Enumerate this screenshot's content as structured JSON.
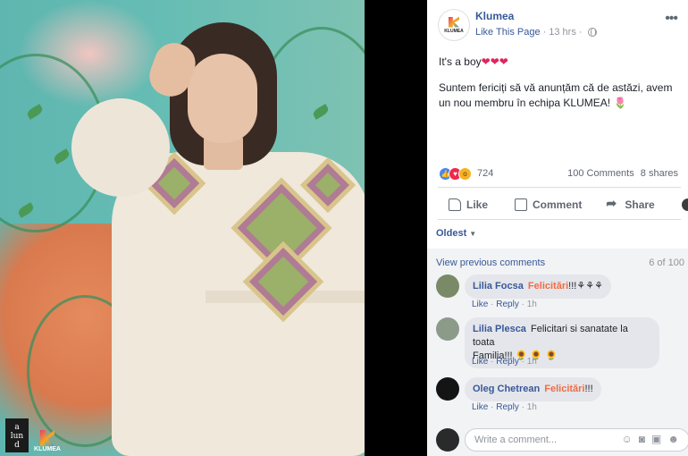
{
  "photo": {
    "watermark_left": "a\nlun\nd",
    "watermark_right": "KLUMEA"
  },
  "post": {
    "page_name": "Klumea",
    "avatar_label": "KLUMEA",
    "like_page": "Like This Page",
    "time": "13 hrs",
    "separator": "·",
    "text_line1": "It's a boy",
    "text_line1_hearts": "❤❤❤",
    "text_line2": "Suntem fericiți să vă anunțăm că de astăzi, avem un nou membru în echipa KLUMEA!",
    "text_line2_emoji": "🌷",
    "reactions_count": "724",
    "comments_count": "100 Comments",
    "shares_count": "8 shares",
    "actions": {
      "like": "Like",
      "comment": "Comment",
      "share": "Share"
    },
    "sort_label": "Oldest",
    "view_previous": "View previous comments",
    "comment_range": "6 of 100"
  },
  "comments": [
    {
      "name": "Lilia Focsa",
      "highlight": "Felicitări",
      "text": "!!!⚘⚘⚘",
      "like": "Like",
      "reply": "Reply",
      "time": "1h"
    },
    {
      "name": "Lilia Plesca",
      "text1": "Felicitari si sanatate la toata",
      "text2": "Familia!!! 🌻 🌻 🌻",
      "like": "Like",
      "reply": "Reply",
      "time": "1h"
    },
    {
      "name": "Oleg Chetrean",
      "highlight": "Felicitări",
      "text": "!!!",
      "like": "Like",
      "reply": "Reply",
      "time": "1h"
    }
  ],
  "composer": {
    "placeholder": "Write a comment..."
  },
  "colors": {
    "link": "#385898",
    "highlight": "#f26b43",
    "heart": "#e0245e"
  }
}
